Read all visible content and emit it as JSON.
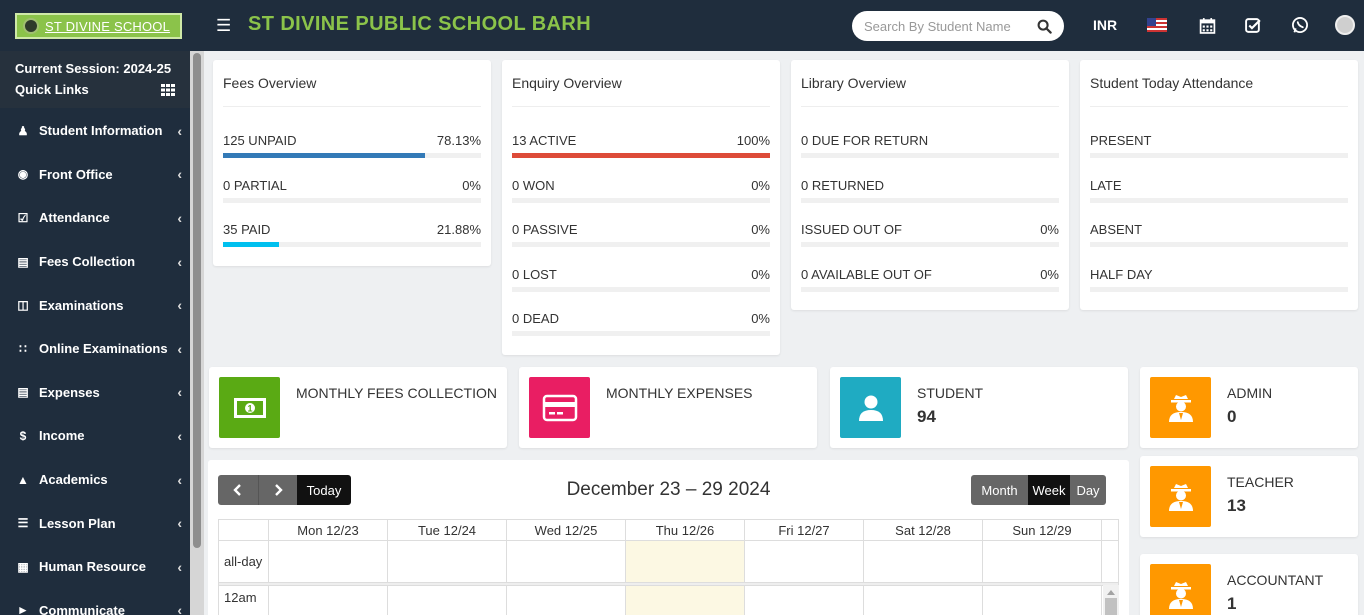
{
  "header": {
    "logo_text": "ST DIVINE SCHOOL",
    "school_name": "ST DIVINE PUBLIC SCHOOL BARH",
    "search_placeholder": "Search By Student Name",
    "currency": "INR"
  },
  "sidebar": {
    "session": "Current Session: 2024-25",
    "quick_links": "Quick Links",
    "items": [
      {
        "label": "Student Information",
        "icon": "user-group-icon"
      },
      {
        "label": "Front Office",
        "icon": "eye-icon"
      },
      {
        "label": "Attendance",
        "icon": "calendar-check-icon"
      },
      {
        "label": "Fees Collection",
        "icon": "money-icon"
      },
      {
        "label": "Examinations",
        "icon": "map-icon"
      },
      {
        "label": "Online Examinations",
        "icon": "rss-icon"
      },
      {
        "label": "Expenses",
        "icon": "credit-card-icon"
      },
      {
        "label": "Income",
        "icon": "dollar-icon"
      },
      {
        "label": "Academics",
        "icon": "graduation-cap-icon"
      },
      {
        "label": "Lesson Plan",
        "icon": "list-icon"
      },
      {
        "label": "Human Resource",
        "icon": "sitemap-icon"
      },
      {
        "label": "Communicate",
        "icon": "bullhorn-icon"
      }
    ]
  },
  "fees_overview": {
    "title": "Fees Overview",
    "rows": [
      {
        "label": "125 UNPAID",
        "pct": "78.13%",
        "fill": 0.7813,
        "color": "#337ab7"
      },
      {
        "label": "0 PARTIAL",
        "pct": "0%",
        "fill": 0,
        "color": "#f39c12"
      },
      {
        "label": "35 PAID",
        "pct": "21.88%",
        "fill": 0.2188,
        "color": "#00c0ef"
      }
    ]
  },
  "enquiry_overview": {
    "title": "Enquiry Overview",
    "rows": [
      {
        "label": "13 ACTIVE",
        "pct": "100%",
        "fill": 1,
        "color": "#dd4b39"
      },
      {
        "label": "0 WON",
        "pct": "0%",
        "fill": 0,
        "color": "#00a65a"
      },
      {
        "label": "0 PASSIVE",
        "pct": "0%",
        "fill": 0,
        "color": "#f39c12"
      },
      {
        "label": "0 LOST",
        "pct": "0%",
        "fill": 0,
        "color": "#dd4b39"
      },
      {
        "label": "0 DEAD",
        "pct": "0%",
        "fill": 0,
        "color": "#555"
      }
    ]
  },
  "library_overview": {
    "title": "Library Overview",
    "rows": [
      {
        "label": "0 DUE FOR RETURN",
        "pct": "",
        "fill": 0,
        "color": "#dd4b39"
      },
      {
        "label": "0 RETURNED",
        "pct": "",
        "fill": 0,
        "color": "#00a65a"
      },
      {
        "label": "ISSUED OUT OF",
        "pct": "0%",
        "fill": 0,
        "color": "#337ab7"
      },
      {
        "label": "0 AVAILABLE OUT OF",
        "pct": "0%",
        "fill": 0,
        "color": "#00c0ef"
      }
    ]
  },
  "attendance_overview": {
    "title": "Student Today Attendance",
    "rows": [
      {
        "label": "PRESENT",
        "pct": "",
        "fill": 0,
        "color": "#00a65a"
      },
      {
        "label": "LATE",
        "pct": "",
        "fill": 0,
        "color": "#f39c12"
      },
      {
        "label": "ABSENT",
        "pct": "",
        "fill": 0,
        "color": "#dd4b39"
      },
      {
        "label": "HALF DAY",
        "pct": "",
        "fill": 0,
        "color": "#337ab7"
      }
    ]
  },
  "stats": {
    "monthly_fees": {
      "label": "MONTHLY FEES COLLECTION",
      "color": "#5aaa14"
    },
    "monthly_expenses": {
      "label": "MONTHLY EXPENSES",
      "color": "#e91e63"
    },
    "student": {
      "label": "STUDENT",
      "value": "94",
      "color": "#1fabc2"
    },
    "admin": {
      "label": "ADMIN",
      "value": "0",
      "color": "#ff9800"
    },
    "teacher": {
      "label": "TEACHER",
      "value": "13",
      "color": "#ff9800"
    },
    "accountant": {
      "label": "ACCOUNTANT",
      "value": "1",
      "color": "#ff9800"
    }
  },
  "calendar": {
    "today_btn": "Today",
    "title": "December 23 – 29 2024",
    "views": [
      "Month",
      "Week",
      "Day"
    ],
    "active_view": "Week",
    "days": [
      "Mon 12/23",
      "Tue 12/24",
      "Wed 12/25",
      "Thu 12/26",
      "Fri 12/27",
      "Sat 12/28",
      "Sun 12/29"
    ],
    "today_index": 3,
    "allday_label": "all-day",
    "first_slot": "12am"
  }
}
